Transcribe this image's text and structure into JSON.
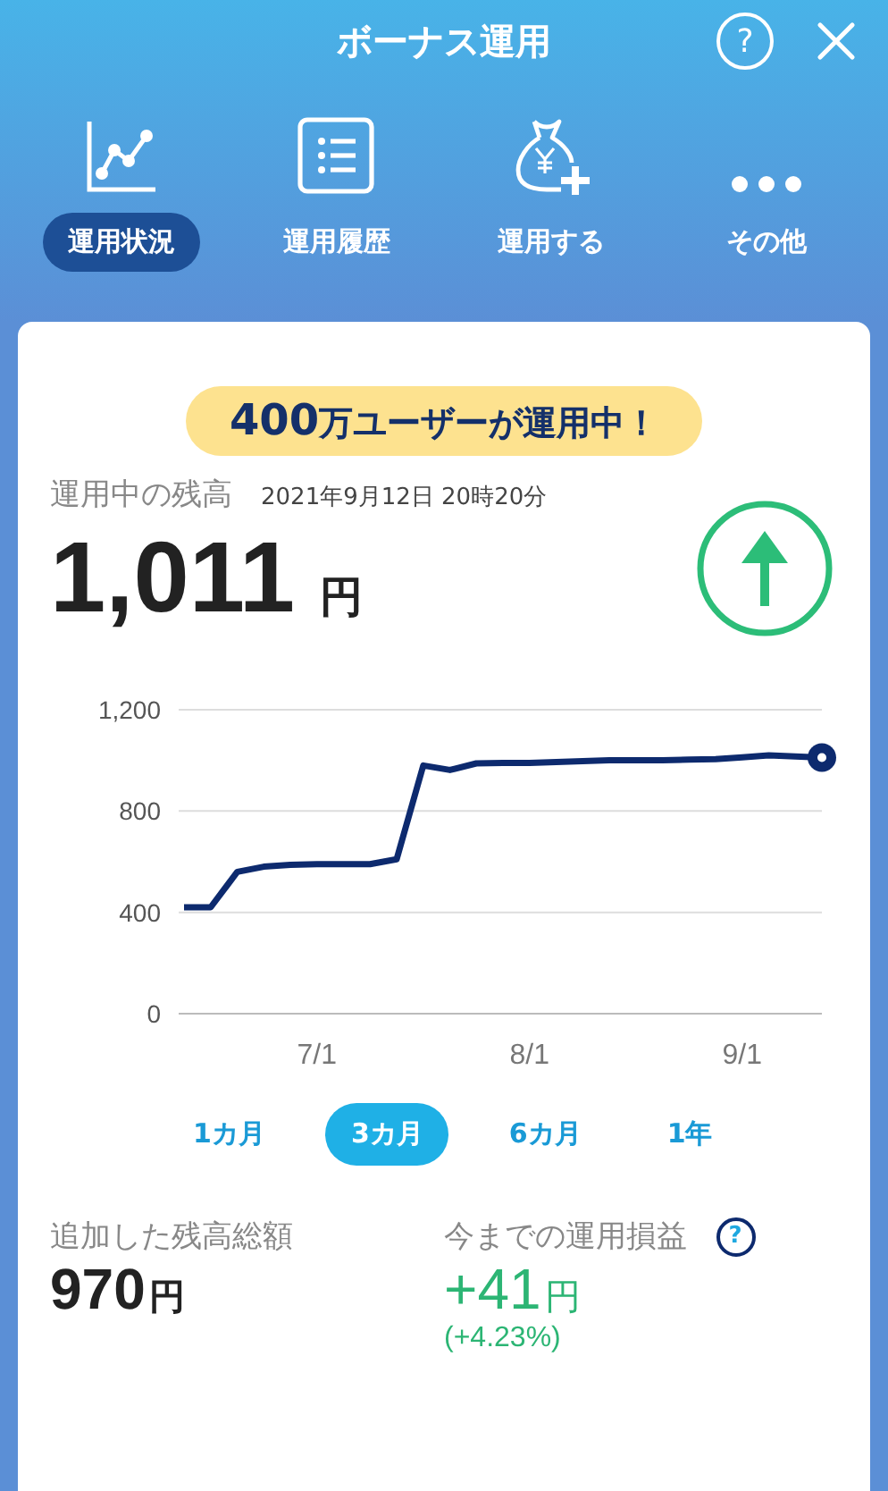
{
  "header": {
    "title": "ボーナス運用",
    "help_icon": "?"
  },
  "nav": [
    {
      "kind": "chart",
      "label": "運用状況",
      "selected": true
    },
    {
      "kind": "list",
      "label": "運用履歴",
      "selected": false
    },
    {
      "kind": "bag",
      "label": "運用する",
      "selected": false
    },
    {
      "kind": "more",
      "label": "その他",
      "selected": false
    }
  ],
  "banner": {
    "count": "400",
    "text": "万ユーザーが運用中！"
  },
  "balance": {
    "label": "運用中の残高",
    "timestamp": "2021年9月12日 20時20分",
    "amount": "1,011",
    "unit": "円",
    "rising": true
  },
  "chart_data": {
    "type": "line",
    "categories": [
      null,
      null,
      null,
      null,
      null,
      "7/1",
      null,
      null,
      null,
      null,
      null,
      null,
      null,
      "8/1",
      null,
      null,
      null,
      null,
      null,
      null,
      null,
      "9/1",
      null,
      null,
      null
    ],
    "series": [
      {
        "color": "#0d2a6e",
        "values": [
          420,
          420,
          560,
          580,
          588,
          590,
          590,
          590,
          610,
          980,
          962,
          988,
          990,
          990,
          993,
          997,
          1000,
          1000,
          1000,
          1003,
          1005,
          1012,
          1020,
          1016,
          1011
        ]
      }
    ],
    "ylim": [
      0,
      1200
    ],
    "yticks": [
      {
        "value": 0,
        "label": "0"
      },
      {
        "value": 400,
        "label": "400"
      },
      {
        "value": 800,
        "label": "800"
      },
      {
        "value": 1200,
        "label": "1,200"
      }
    ]
  },
  "periods": [
    {
      "label": "1カ月",
      "selected": false
    },
    {
      "label": "3カ月",
      "selected": true
    },
    {
      "label": "6カ月",
      "selected": false
    },
    {
      "label": "1年",
      "selected": false
    }
  ],
  "added": {
    "label": "追加した残高総額",
    "amount": "970",
    "unit": "円"
  },
  "profit": {
    "label": "今までの運用損益",
    "help_icon": "?",
    "amount": "+41",
    "unit": "円",
    "percent": "(+4.23%)"
  }
}
